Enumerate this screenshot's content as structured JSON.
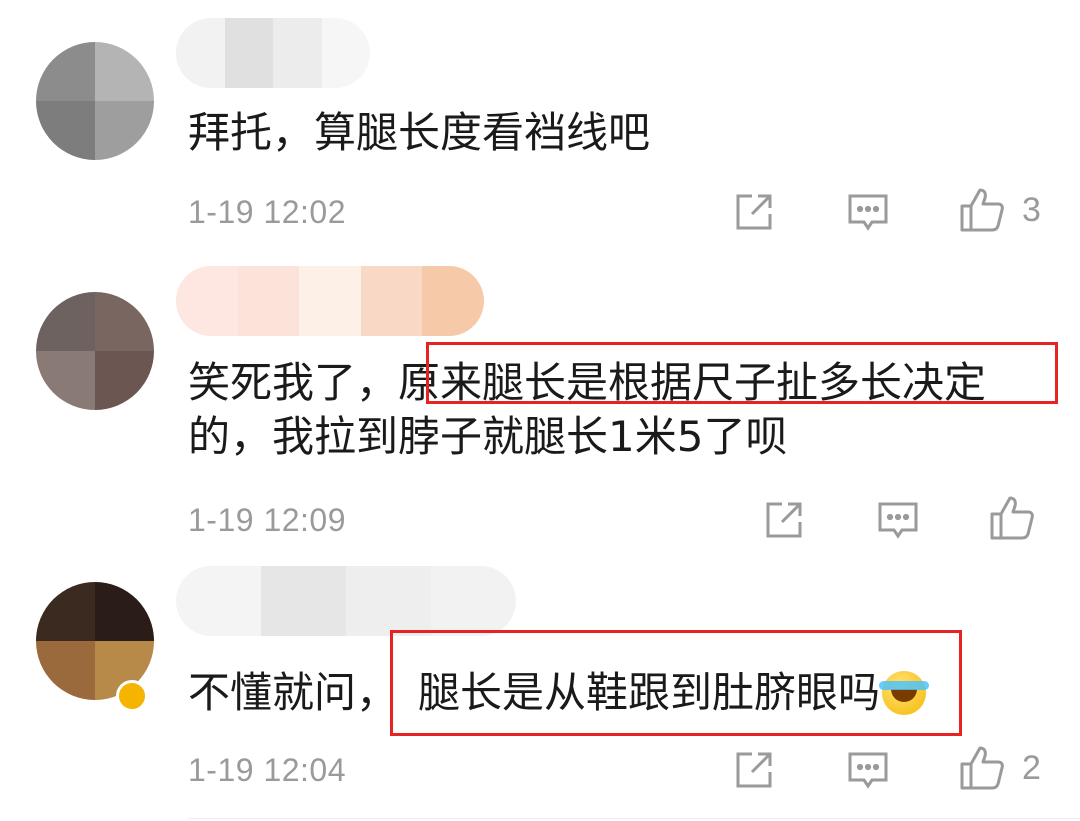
{
  "comments": [
    {
      "text": "拜托，算腿长度看裆线吧",
      "time": "1-19 12:02",
      "like_count": "3",
      "avatar_colors": [
        "#8c8c8c",
        "#b4b4b4",
        "#7d7d7d",
        "#9e9e9e"
      ],
      "name_blur_colors": [
        "#f2f2f2",
        "#e0e0e0",
        "#ececec",
        "#f6f6f6"
      ]
    },
    {
      "text_plain": "笑死我了，",
      "text_highlight": "原来腿长是根据尺子扯多长决定",
      "text_line2": "的，我拉到脖子就腿长1米5了呗",
      "time": "1-19 12:09",
      "like_count": "",
      "avatar_colors": [
        "#6e6260",
        "#7a6661",
        "#8a7a76",
        "#6b5652"
      ],
      "name_blur_colors": [
        "#fde7e0",
        "#fbe3da",
        "#fdf0e6",
        "#f9d8c6",
        "#f6caa8"
      ]
    },
    {
      "text_plain": "不懂就问，",
      "text_highlight": "腿长是从鞋跟到肚脐眼吗",
      "time": "1-19 12:04",
      "like_count": "2",
      "avatar_colors": [
        "#3a2a20",
        "#2a1c16",
        "#9a6a3c",
        "#b88a4a"
      ],
      "name_blur_colors": [
        "#f4f4f4",
        "#e6e6e6",
        "#eeeeee",
        "#f2f2f2"
      ]
    }
  ],
  "icons": {
    "share": "share-icon",
    "comment": "comment-icon",
    "like": "thumbs-up-icon",
    "emoji": "laughing-crying-emoji"
  },
  "colors": {
    "highlight_border": "#e62323",
    "meta_gray": "#9a9a9a",
    "text": "#1a1a1a"
  }
}
